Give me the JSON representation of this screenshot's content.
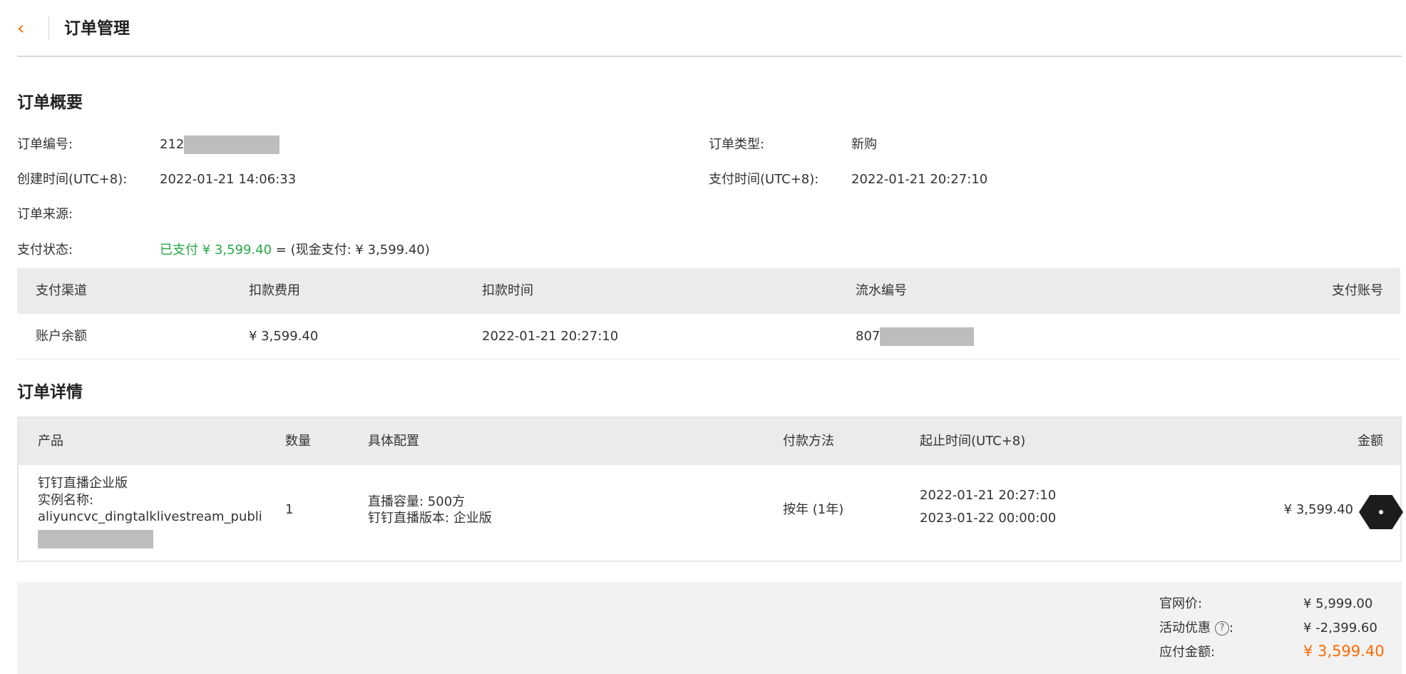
{
  "header": {
    "back_icon": "‹",
    "title": "订单管理"
  },
  "overview": {
    "title": "订单概要",
    "order_no_label": "订单编号:",
    "order_no_visible": "212",
    "order_type_label": "订单类型:",
    "order_type_value": "新购",
    "created_label": "创建时间(UTC+8):",
    "created_value": "2022-01-21 14:06:33",
    "paid_time_label": "支付时间(UTC+8):",
    "paid_time_value": "2022-01-21 20:27:10",
    "source_label": "订单来源:",
    "pay_status_label": "支付状态:",
    "pay_status_paid": "已支付 ¥ 3,599.40",
    "pay_status_detail": " = (现金支付: ¥ 3,599.40)"
  },
  "payment_table": {
    "headers": [
      "支付渠道",
      "扣款费用",
      "扣款时间",
      "流水编号",
      "支付账号"
    ],
    "row": {
      "channel": "账户余额",
      "amount": "¥ 3,599.40",
      "time": "2022-01-21 20:27:10",
      "serial_visible": "807"
    }
  },
  "detail": {
    "title": "订单详情",
    "headers": [
      "产品",
      "数量",
      "具体配置",
      "付款方法",
      "起止时间(UTC+8)",
      "金额"
    ],
    "row": {
      "product_name": "钉钉直播企业版",
      "instance_label": "实例名称:",
      "instance_value": "aliyuncvc_dingtalklivestream_publi",
      "quantity": "1",
      "config_line1": "直播容量: 500方",
      "config_line2_label": "钉钉直播版本: ",
      "config_line2_value": "企业版",
      "pay_method": "按年 (1年)",
      "start_time": "2022-01-21 20:27:10",
      "end_time": "2023-01-22 00:00:00",
      "amount": "¥ 3,599.40"
    }
  },
  "summary": {
    "list_price_label": "官网价:",
    "list_price_value": "¥ 5,999.00",
    "discount_label": "活动优惠",
    "discount_help": "?",
    "discount_colon": ":",
    "discount_value": "¥ -2,399.60",
    "payable_label": "应付金额:",
    "payable_value": "¥ 3,599.40"
  },
  "colors": {
    "accent": "#ff6a00",
    "paid_green": "#28a745",
    "header_bg": "#ebebeb"
  }
}
